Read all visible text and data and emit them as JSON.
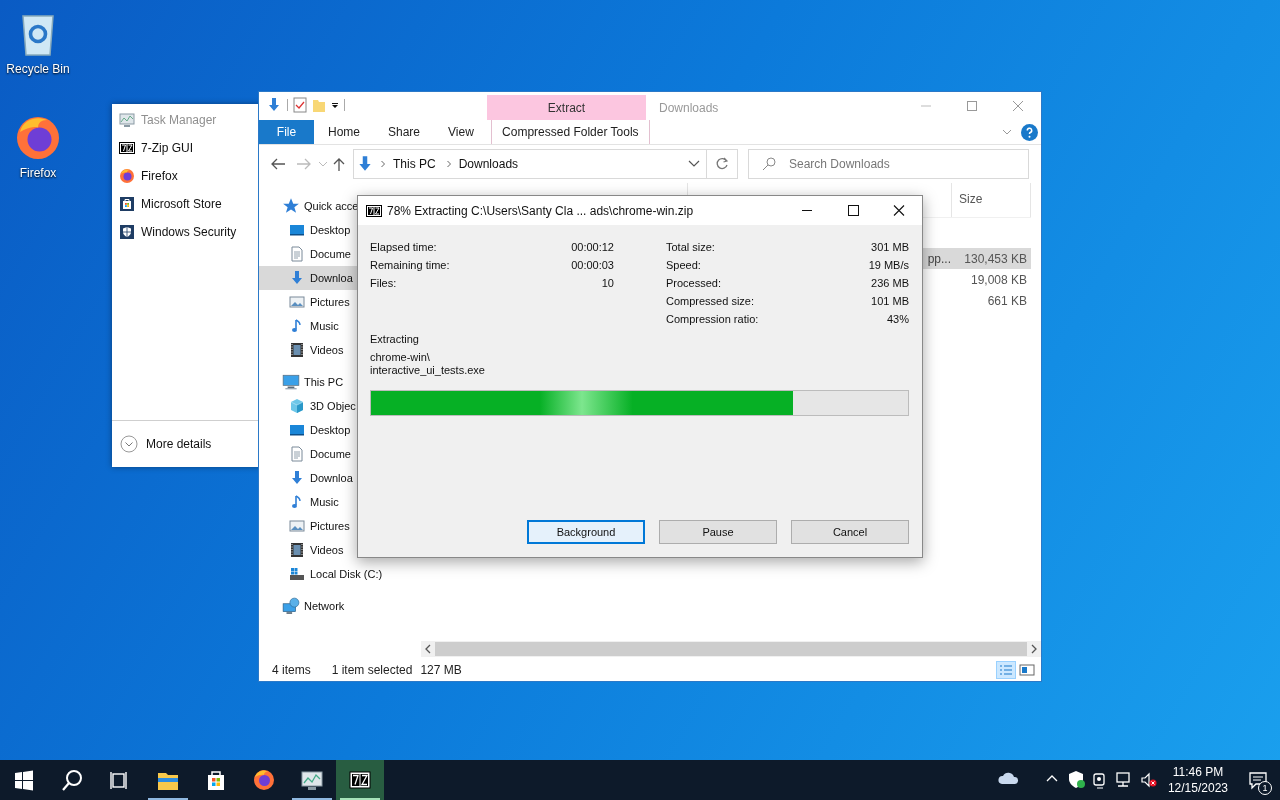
{
  "desktop_icons": [
    {
      "label": "Recycle Bin",
      "kind": "recycle"
    },
    {
      "label": "Firefox",
      "kind": "firefox"
    }
  ],
  "jump_list": {
    "items": [
      {
        "label": "Task Manager",
        "kind": "taskmgr",
        "disabled": true
      },
      {
        "label": "7-Zip GUI",
        "kind": "sevenzip",
        "disabled": false
      },
      {
        "label": "Firefox",
        "kind": "firefox",
        "disabled": false
      },
      {
        "label": "Microsoft Store",
        "kind": "store",
        "disabled": false
      },
      {
        "label": "Windows Security",
        "kind": "shield",
        "disabled": false
      }
    ],
    "more_details": "More details"
  },
  "explorer": {
    "title": "Downloads",
    "context_tab": "Extract",
    "ribbon_tabs": [
      {
        "label": "File",
        "kind": "file"
      },
      {
        "label": "Home",
        "kind": "plain"
      },
      {
        "label": "Share",
        "kind": "plain"
      },
      {
        "label": "View",
        "kind": "plain"
      },
      {
        "label": "Compressed Folder Tools",
        "kind": "context"
      }
    ],
    "address": [
      "This PC",
      "Downloads"
    ],
    "search": {
      "placeholder": "Search Downloads"
    },
    "nav": [
      {
        "label": "Quick acce",
        "kind": "star",
        "selected": false,
        "children": [
          {
            "label": "Desktop",
            "kind": "desktop",
            "selected": false
          },
          {
            "label": "Docume",
            "kind": "document",
            "selected": false
          },
          {
            "label": "Downloa",
            "kind": "download",
            "selected": true
          },
          {
            "label": "Pictures",
            "kind": "pictures",
            "selected": false
          },
          {
            "label": "Music",
            "kind": "music",
            "selected": false
          },
          {
            "label": "Videos",
            "kind": "videos",
            "selected": false
          }
        ]
      },
      {
        "label": "This PC",
        "kind": "pc",
        "selected": false,
        "children": [
          {
            "label": "3D Objec",
            "kind": "cube",
            "selected": false
          },
          {
            "label": "Desktop",
            "kind": "desktop",
            "selected": false
          },
          {
            "label": "Docume",
            "kind": "document",
            "selected": false
          },
          {
            "label": "Downloa",
            "kind": "download",
            "selected": false
          },
          {
            "label": "Music",
            "kind": "music",
            "selected": false
          },
          {
            "label": "Pictures",
            "kind": "pictures",
            "selected": false
          },
          {
            "label": "Videos",
            "kind": "videos",
            "selected": false
          },
          {
            "label": "Local Disk (C:)",
            "kind": "disk",
            "selected": false
          }
        ]
      },
      {
        "label": "Network",
        "kind": "network",
        "selected": false
      }
    ],
    "columns": [
      {
        "label": "Size"
      }
    ],
    "rows": [
      {
        "column_1": "pp...",
        "size": "130,453 KB",
        "selected": true
      },
      {
        "size": "19,008 KB",
        "selected": false
      },
      {
        "size": "661 KB",
        "selected": false
      }
    ],
    "status_bar": {
      "item_count": "4 items",
      "selection": "1 item selected",
      "selection_size": "127 MB"
    }
  },
  "dialog": {
    "title": "78% Extracting C:\\Users\\Santy Cla ... ads\\chrome-win.zip",
    "left_stats": [
      {
        "label": "Elapsed time:",
        "value": "00:00:12"
      },
      {
        "label": "Remaining time:",
        "value": "00:00:03"
      },
      {
        "label": "Files:",
        "value": "10"
      }
    ],
    "right_stats": [
      {
        "label": "Total size:",
        "value": "301 MB"
      },
      {
        "label": "Speed:",
        "value": "19 MB/s"
      },
      {
        "label": "Processed:",
        "value": "236 MB"
      },
      {
        "label": "Compressed size:",
        "value": "101 MB"
      },
      {
        "label": "Compression ratio:",
        "value": "43%"
      }
    ],
    "operation": "Extracting",
    "current_file": [
      "chrome-win\\",
      "interactive_ui_tests.exe"
    ],
    "progress": {
      "level": 0.785
    },
    "buttons": [
      {
        "label": "Background",
        "focused": true
      },
      {
        "label": "Pause",
        "focused": false
      },
      {
        "label": "Cancel",
        "focused": false
      }
    ]
  },
  "taskbar": {
    "apps": [
      {
        "kind": "start",
        "running": false,
        "active": false
      },
      {
        "kind": "search",
        "running": false,
        "active": false
      },
      {
        "kind": "taskview",
        "running": false,
        "active": false
      },
      {
        "kind": "explorer",
        "running": true,
        "active": false
      },
      {
        "kind": "store",
        "running": false,
        "active": false
      },
      {
        "kind": "firefox",
        "running": false,
        "active": false
      },
      {
        "kind": "taskmgr",
        "running": true,
        "active": false
      },
      {
        "kind": "sevenzip",
        "running": true,
        "active": true
      }
    ],
    "tray": [
      {
        "kind": "cloud"
      },
      {
        "kind": "chevron"
      },
      {
        "kind": "shield"
      },
      {
        "kind": "camera"
      },
      {
        "kind": "network"
      },
      {
        "kind": "volume"
      }
    ],
    "time": "11:46 PM",
    "date": "12/15/2023",
    "notifications": "1"
  }
}
